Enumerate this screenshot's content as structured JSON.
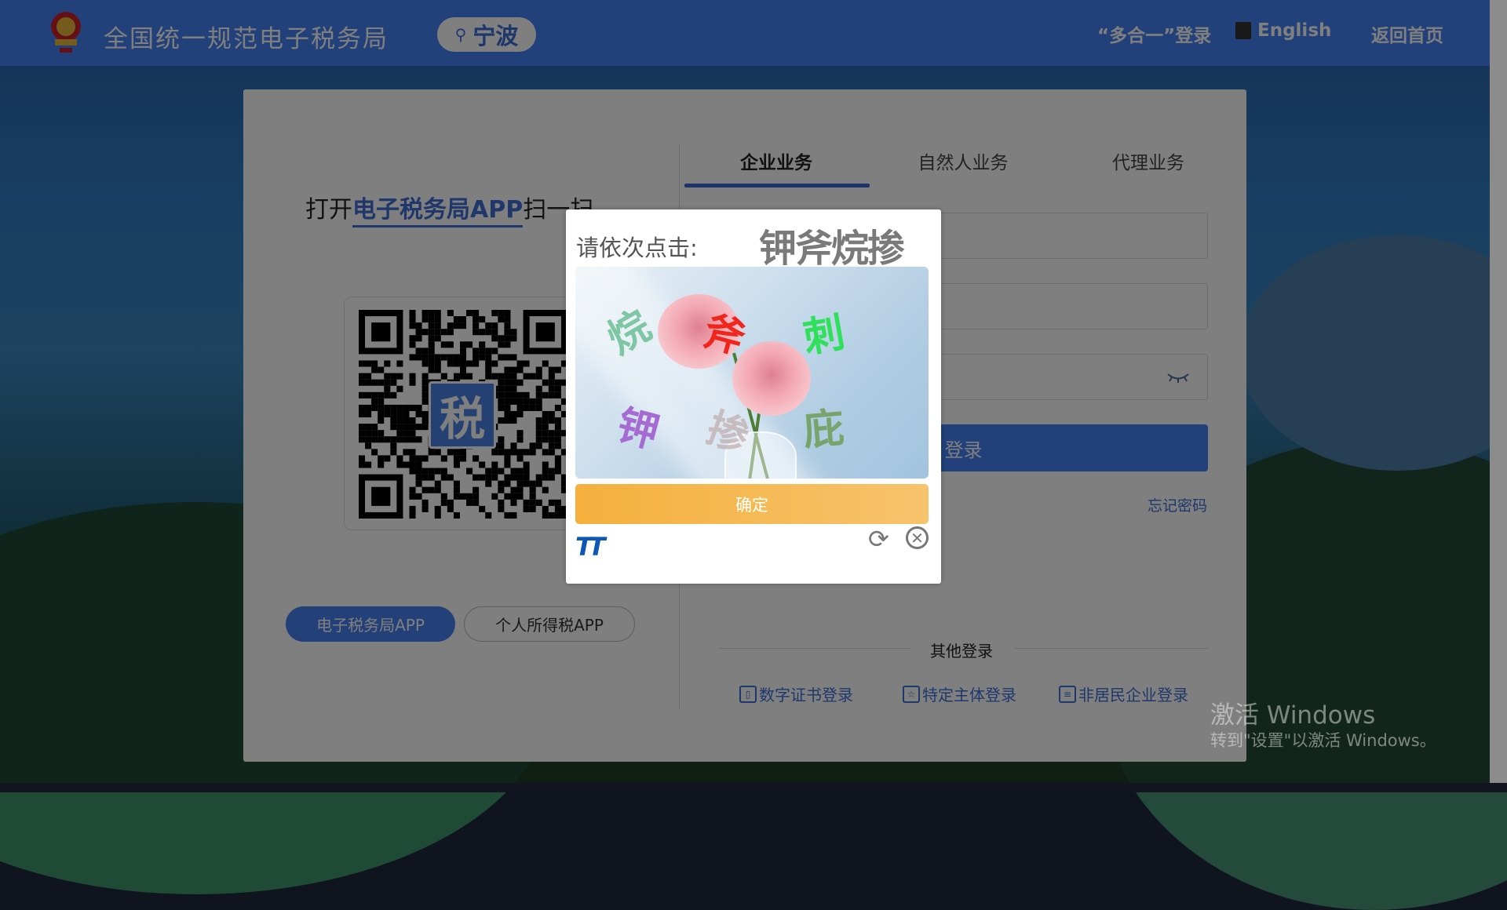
{
  "header": {
    "site_title": "全国统一规范电子税务局",
    "city": "宁波",
    "multi_login": "“多合一”登录",
    "english": "English",
    "home": "返回首页",
    "logo_text": "国家税务总局"
  },
  "left": {
    "scan_prefix": "打开",
    "scan_app": "电子税务局APP",
    "scan_suffix": "扫一扫",
    "qr_logo": "税",
    "buttons": [
      "电子税务局APP",
      "个人所得税APP"
    ]
  },
  "tabs": [
    "企业业务",
    "自然人业务",
    "代理业务"
  ],
  "form": {
    "login": "登录",
    "forgot": "忘记密码"
  },
  "other": {
    "title": "其他登录",
    "links": [
      "数字证书登录",
      "特定主体登录",
      "非居民企业登录"
    ]
  },
  "captcha": {
    "prompt": "请依次点击:",
    "targets": "钾斧烷掺",
    "chars": [
      "烷",
      "斧",
      "刺",
      "钾",
      "掺",
      "庇"
    ],
    "confirm": "确定",
    "brand": "TT"
  },
  "watermark": {
    "line1": "激活 Windows",
    "line2": "转到\"设置\"以激活 Windows。"
  },
  "colors": {
    "brand": "#4483f5",
    "confirm": "#f5b03d"
  }
}
